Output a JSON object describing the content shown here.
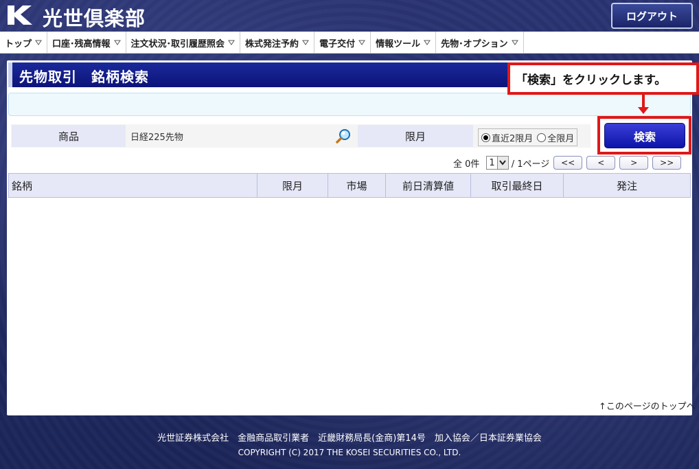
{
  "header": {
    "site_title": "光世倶楽部",
    "logout_label": "ログアウト"
  },
  "nav": {
    "items": [
      {
        "label": "トップ"
      },
      {
        "label": "口座･残高情報"
      },
      {
        "label": "注文状況･取引履歴照会"
      },
      {
        "label": "株式発注予約"
      },
      {
        "label": "電子交付"
      },
      {
        "label": "情報ツール"
      },
      {
        "label": "先物･オプション"
      }
    ]
  },
  "page": {
    "title": "先物取引　銘柄検索"
  },
  "search": {
    "product_label": "商品",
    "product_value": "日経225先物",
    "month_label": "限月",
    "radio_recent": "直近2限月",
    "radio_all": "全限月",
    "selected": "recent",
    "search_button": "検索"
  },
  "callout": {
    "text": "「検索」をクリックします。"
  },
  "pager": {
    "total": "全 0件",
    "page_value": "1",
    "page_suffix": "/ 1ページ",
    "first": "<<",
    "prev": "<",
    "next": ">",
    "last": ">>"
  },
  "table": {
    "headers": [
      "銘柄",
      "限月",
      "市場",
      "前日清算値",
      "取引最終日",
      "発注"
    ]
  },
  "to_top": "↑このページのトップへ",
  "footer": {
    "line1": "光世証券株式会社　金融商品取引業者　近畿財務局長(金商)第14号　加入協会／日本証券業協会",
    "line2": "COPYRIGHT (C) 2017 THE KOSEI SECURITIES CO., LTD."
  },
  "colors": {
    "background": "#1f2a5e",
    "title_bar": "#0d137a",
    "search_button": "#0d14a8",
    "highlight": "#e01818"
  }
}
